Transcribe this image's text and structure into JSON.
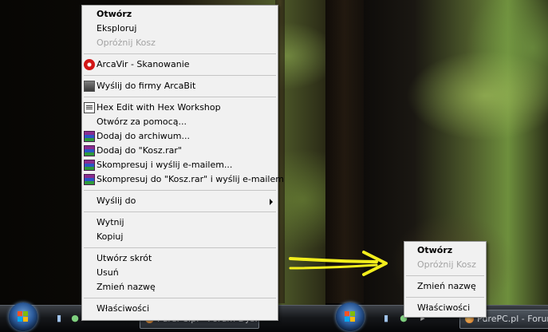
{
  "left_menu": {
    "items": [
      {
        "label": "Otwórz",
        "style": "bold",
        "icon": null
      },
      {
        "label": "Eksploruj",
        "style": "normal",
        "icon": null
      },
      {
        "label": "Opróżnij Kosz",
        "style": "disabled",
        "icon": null
      },
      {
        "separator": true
      },
      {
        "label": "ArcaVir - Skanowanie",
        "style": "normal",
        "icon": "arcavir-icon"
      },
      {
        "separator": true
      },
      {
        "label": "Wyślij do firmy ArcaBit",
        "style": "normal",
        "icon": "arcabit-icon"
      },
      {
        "separator": true
      },
      {
        "label": "Hex Edit with Hex Workshop",
        "style": "normal",
        "icon": "hex-workshop-icon"
      },
      {
        "label": "Otwórz za pomocą...",
        "style": "normal",
        "icon": null
      },
      {
        "label": "Dodaj do archiwum...",
        "style": "normal",
        "icon": "winrar-icon"
      },
      {
        "label": "Dodaj do \"Kosz.rar\"",
        "style": "normal",
        "icon": "winrar-icon"
      },
      {
        "label": "Skompresuj i wyślij e-mailem...",
        "style": "normal",
        "icon": "winrar-icon"
      },
      {
        "label": "Skompresuj do \"Kosz.rar\" i wyślij e-mailem",
        "style": "normal",
        "icon": "winrar-icon"
      },
      {
        "separator": true
      },
      {
        "label": "Wyślij do",
        "style": "normal",
        "icon": null,
        "submenu": true
      },
      {
        "separator": true
      },
      {
        "label": "Wytnij",
        "style": "normal",
        "icon": null
      },
      {
        "label": "Kopiuj",
        "style": "normal",
        "icon": null
      },
      {
        "separator": true
      },
      {
        "label": "Utwórz skrót",
        "style": "normal",
        "icon": null
      },
      {
        "label": "Usuń",
        "style": "normal",
        "icon": null
      },
      {
        "label": "Zmień nazwę",
        "style": "normal",
        "icon": null
      },
      {
        "separator": true
      },
      {
        "label": "Właściwości",
        "style": "normal",
        "icon": null
      }
    ]
  },
  "right_menu": {
    "items": [
      {
        "label": "Otwórz",
        "style": "bold"
      },
      {
        "label": "Opróżnij Kosz",
        "style": "disabled"
      },
      {
        "separator": true
      },
      {
        "label": "Zmień nazwę",
        "style": "normal"
      },
      {
        "separator": true
      },
      {
        "label": "Właściwości",
        "style": "normal"
      }
    ]
  },
  "taskbar": {
    "left_task_label": "PurePC.pl - Forum Dys...",
    "right_task_label": "PurePC.pl - Forum"
  },
  "colors": {
    "menu_bg": "#f1f1f1",
    "disabled_text": "#a3a3a3",
    "arrow": "#f2ee1c"
  }
}
